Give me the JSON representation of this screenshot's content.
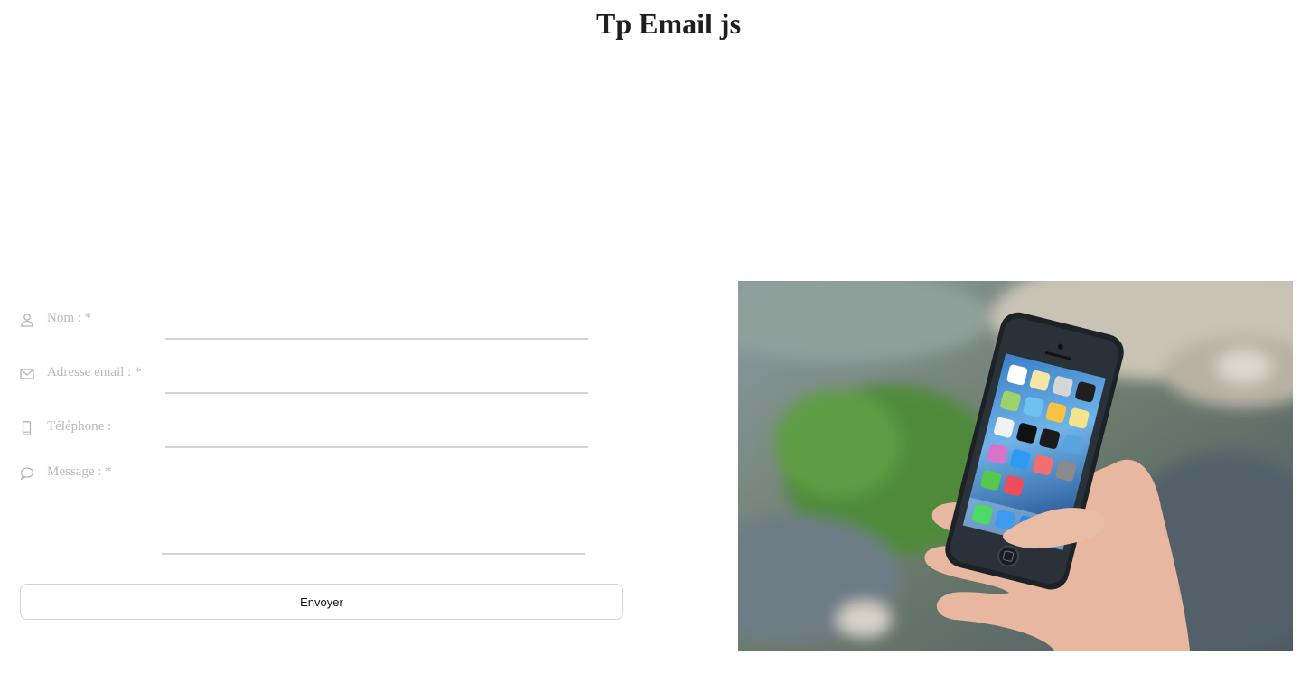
{
  "page": {
    "title": "Tp Email js"
  },
  "form": {
    "name": {
      "label": "Nom : *",
      "icon": "user-icon",
      "value": ""
    },
    "email": {
      "label": "Adresse email : *",
      "icon": "envelope-icon",
      "value": ""
    },
    "phone": {
      "label": "Téléphone :",
      "icon": "phone-icon",
      "value": ""
    },
    "message": {
      "label": "Message : *",
      "icon": "speech-bubble-icon",
      "value": ""
    },
    "submit_label": "Envoyer"
  },
  "colors": {
    "label": "#b9b9b9",
    "underline": "#d3d3d3",
    "title": "#1e1e1e"
  },
  "image": {
    "subject": "hand-holding-smartphone-photo"
  }
}
